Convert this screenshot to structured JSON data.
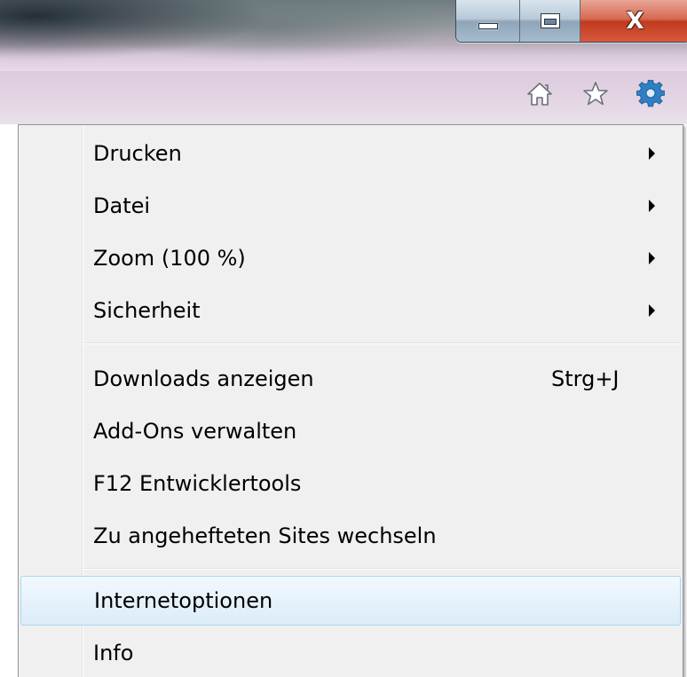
{
  "window": {
    "caption_buttons": {
      "minimize_icon": "minimize-icon",
      "maximize_icon": "maximize-icon",
      "close_label": "X"
    }
  },
  "toolbar": {
    "icons": [
      "home-icon",
      "star-icon",
      "gear-icon"
    ]
  },
  "tools_menu": {
    "items": [
      {
        "label": "Drucken",
        "submenu": true
      },
      {
        "label": "Datei",
        "submenu": true
      },
      {
        "label": "Zoom (100 %)",
        "submenu": true
      },
      {
        "label": "Sicherheit",
        "submenu": true
      },
      {
        "label": "Downloads anzeigen",
        "shortcut": "Strg+J"
      },
      {
        "label": "Add-Ons verwalten"
      },
      {
        "label": "F12 Entwicklertools"
      },
      {
        "label": "Zu angehefteten Sites wechseln"
      },
      {
        "label": "Internetoptionen",
        "highlighted": true
      },
      {
        "label": "Info"
      }
    ]
  },
  "colors": {
    "menu_background": "#f0f0f0",
    "highlight_border": "#a8d8f0",
    "gear_icon": "#2f7fc4",
    "close_button": "#c8452b"
  }
}
